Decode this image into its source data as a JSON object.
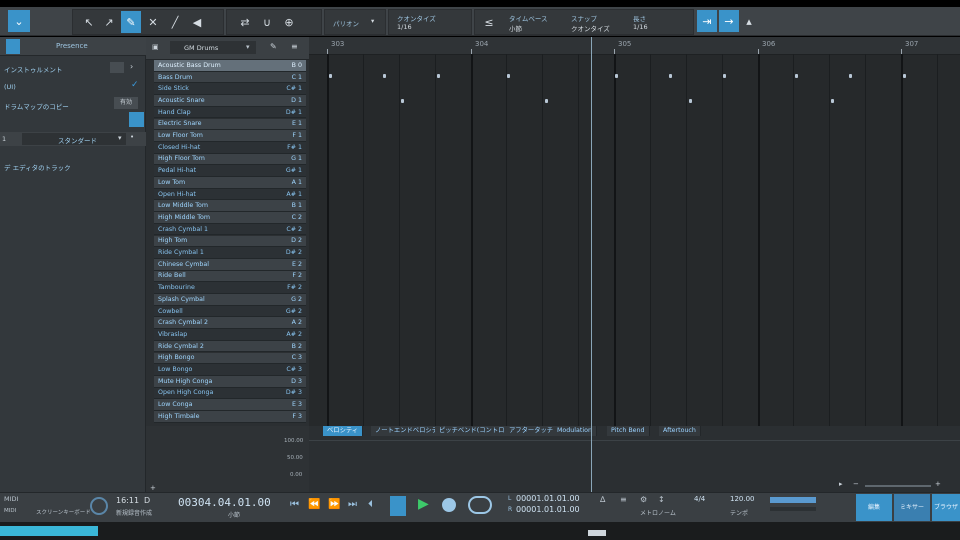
{
  "toolbar": {
    "menu_label": "パリオン",
    "quantize": {
      "label": "クオンタイズ",
      "value": "1/16"
    },
    "timebase": {
      "label": "タイムベース",
      "value": "小節"
    },
    "snap": {
      "label": "スナップ",
      "value": "クオンタイズ"
    },
    "length": {
      "label": "長さ",
      "value": "1/16"
    }
  },
  "inspector": {
    "tab_label": "Presence",
    "row1": "インストゥルメント",
    "row2": "(UI)",
    "row3": "ドラムマップのコピー",
    "row3_value": "有効",
    "row4_value": "スタンダード",
    "note": "デ エディタのトラック"
  },
  "drumlist": {
    "kit_name": "GM Drums",
    "items": [
      {
        "name": "Acoustic Bass Drum",
        "pitch": "B 0"
      },
      {
        "name": "Bass Drum",
        "pitch": "C 1"
      },
      {
        "name": "Side Stick",
        "pitch": "C# 1"
      },
      {
        "name": "Acoustic Snare",
        "pitch": "D 1"
      },
      {
        "name": "Hand Clap",
        "pitch": "D# 1"
      },
      {
        "name": "Electric Snare",
        "pitch": "E 1"
      },
      {
        "name": "Low Floor Tom",
        "pitch": "F 1"
      },
      {
        "name": "Closed Hi-hat",
        "pitch": "F# 1"
      },
      {
        "name": "High Floor Tom",
        "pitch": "G 1"
      },
      {
        "name": "Pedal Hi-hat",
        "pitch": "G# 1"
      },
      {
        "name": "Low Tom",
        "pitch": "A 1"
      },
      {
        "name": "Open Hi-hat",
        "pitch": "A# 1"
      },
      {
        "name": "Low Middle Tom",
        "pitch": "B 1"
      },
      {
        "name": "High Middle Tom",
        "pitch": "C 2"
      },
      {
        "name": "Crash Cymbal 1",
        "pitch": "C# 2"
      },
      {
        "name": "High Tom",
        "pitch": "D 2"
      },
      {
        "name": "Ride Cymbal 1",
        "pitch": "D# 2"
      },
      {
        "name": "Chinese Cymbal",
        "pitch": "E 2"
      },
      {
        "name": "Ride Bell",
        "pitch": "F 2"
      },
      {
        "name": "Tambourine",
        "pitch": "F# 2"
      },
      {
        "name": "Splash Cymbal",
        "pitch": "G 2"
      },
      {
        "name": "Cowbell",
        "pitch": "G# 2"
      },
      {
        "name": "Crash Cymbal 2",
        "pitch": "A 2"
      },
      {
        "name": "Vibraslap",
        "pitch": "A# 2"
      },
      {
        "name": "Ride Cymbal 2",
        "pitch": "B 2"
      },
      {
        "name": "High Bongo",
        "pitch": "C 3"
      },
      {
        "name": "Low Bongo",
        "pitch": "C# 3"
      },
      {
        "name": "Mute High Conga",
        "pitch": "D 3"
      },
      {
        "name": "Open High Conga",
        "pitch": "D# 3"
      },
      {
        "name": "Low Conga",
        "pitch": "E 3"
      },
      {
        "name": "High Timbale",
        "pitch": "F 3"
      }
    ]
  },
  "ruler": {
    "bars": [
      "303",
      "304",
      "305",
      "306",
      "307"
    ]
  },
  "lower_tabs": [
    "ベロシティ",
    "ノートエンドベロシティ",
    "ピッチベンド(コントロール)",
    "アフタータッチ",
    "Modulation",
    "Pitch Bend",
    "Aftertouch"
  ],
  "velocity_scale": [
    "100.00",
    "50.00",
    "0.00"
  ],
  "transport": {
    "time": "16:11",
    "time_suffix": "D",
    "position": "00304.04.01.00",
    "position_sub": "小節",
    "left_loc": "00001.01.01.00",
    "right_loc": "00001.01.01.00",
    "signature": "4/4",
    "tempo": "120.00",
    "left_status": "MIDI",
    "left_status2": "スクリーンキーボード",
    "record_mode": "新規録音作成",
    "metronome_label": "メトロノーム",
    "tempo_label": "テンポ",
    "button_a": "編集",
    "button_b": "ミキサー",
    "button_c": "ブラウザ"
  }
}
